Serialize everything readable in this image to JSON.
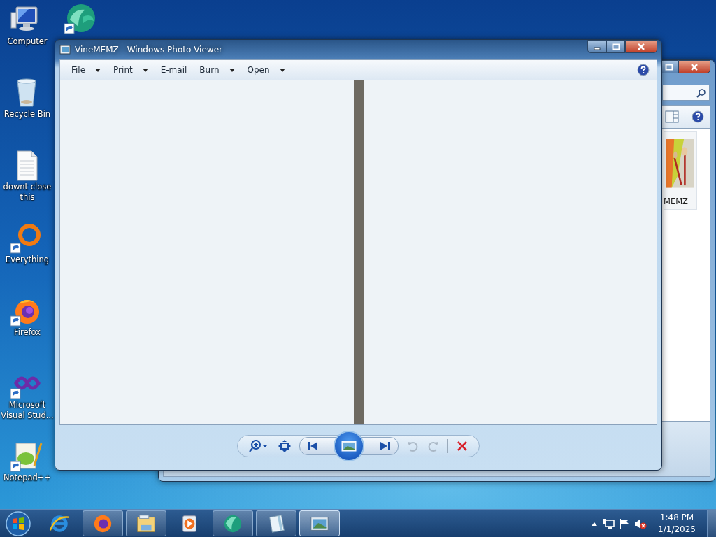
{
  "desktop_icons": [
    {
      "label": "Computer",
      "kind": "computer",
      "shortcut": false
    },
    {
      "label": "Recycle Bin",
      "kind": "recycle",
      "shortcut": false
    },
    {
      "label": "downt close this",
      "kind": "document",
      "shortcut": false
    },
    {
      "label": "Everything",
      "kind": "everything",
      "shortcut": true
    },
    {
      "label": "Firefox",
      "kind": "firefox",
      "shortcut": true
    },
    {
      "label": "Microsoft Visual Stud...",
      "kind": "visualstudio",
      "shortcut": true
    },
    {
      "label": "Notepad++",
      "kind": "notepad",
      "shortcut": true
    }
  ],
  "extra_desktop_icon": {
    "kind": "vine",
    "shortcut": true
  },
  "explorer_window": {
    "thumbnail_label": "MEMZ"
  },
  "photo_viewer": {
    "title": "VineMEMZ - Windows Photo Viewer",
    "menu": [
      {
        "label": "File",
        "dropdown": true
      },
      {
        "label": "Print",
        "dropdown": true
      },
      {
        "label": "E-mail",
        "dropdown": false
      },
      {
        "label": "Burn",
        "dropdown": true
      },
      {
        "label": "Open",
        "dropdown": true
      }
    ],
    "controls": [
      {
        "kind": "zoom",
        "disabled": false
      },
      {
        "kind": "fit",
        "disabled": false
      },
      {
        "kind": "prev",
        "disabled": false
      },
      {
        "kind": "slideshow",
        "disabled": false
      },
      {
        "kind": "next",
        "disabled": false
      },
      {
        "kind": "rotate_left",
        "disabled": true
      },
      {
        "kind": "rotate_right",
        "disabled": true
      },
      {
        "kind": "delete",
        "disabled": false
      }
    ]
  },
  "taskbar": {
    "items": [
      {
        "kind": "ie",
        "running": false,
        "selected": false
      },
      {
        "kind": "firefox",
        "running": true,
        "selected": false
      },
      {
        "kind": "explorer",
        "running": true,
        "selected": false
      },
      {
        "kind": "mediaplayer",
        "running": false,
        "selected": false
      },
      {
        "kind": "vine",
        "running": true,
        "selected": false
      },
      {
        "kind": "notepad",
        "running": true,
        "selected": false
      },
      {
        "kind": "photoviewer",
        "running": true,
        "selected": true
      }
    ],
    "tray": [
      {
        "kind": "arrow"
      },
      {
        "kind": "network"
      },
      {
        "kind": "flag"
      },
      {
        "kind": "speaker_muted"
      }
    ],
    "time": "1:48 PM",
    "date": "1/1/2025"
  }
}
